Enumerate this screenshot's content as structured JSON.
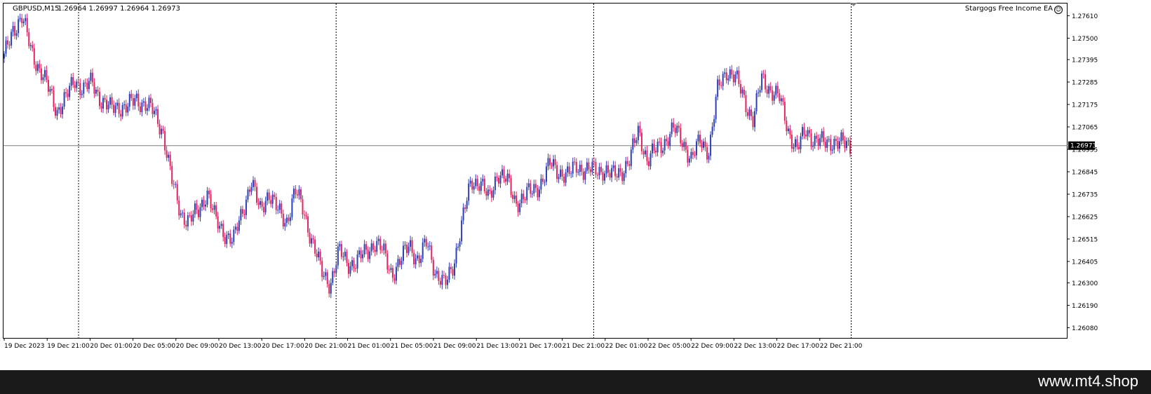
{
  "header": {
    "symbol": "GBPUSD,M15",
    "ohlc": "1.26964 1.26997 1.26964 1.26973",
    "ea_name": "Stargogs Free Income EA"
  },
  "icons": {
    "ea_status": "smiley-icon"
  },
  "watermark": "www.mt4.shop",
  "colors": {
    "bull": "#2a3fb8",
    "bear": "#e0245e",
    "grid": "#000000",
    "bid_line": "#7f7f7f",
    "price_label_bg": "#000000",
    "footer_bg": "#1a1a1a"
  },
  "chart_data": {
    "type": "candlestick",
    "symbol": "GBPUSD",
    "timeframe": "M15",
    "current_price": 1.26973,
    "current_price_label": "1.26973",
    "ylim": [
      1.2603,
      1.2767
    ],
    "y_ticks": [
      "1.27610",
      "1.27500",
      "1.27395",
      "1.27285",
      "1.27175",
      "1.27065",
      "1.26955",
      "1.26845",
      "1.26735",
      "1.26625",
      "1.26515",
      "1.26405",
      "1.26300",
      "1.26190",
      "1.26080"
    ],
    "x_ticks": [
      "19 Dec 2023",
      "19 Dec 21:00",
      "20 Dec 01:00",
      "20 Dec 05:00",
      "20 Dec 09:00",
      "20 Dec 13:00",
      "20 Dec 17:00",
      "20 Dec 21:00",
      "21 Dec 01:00",
      "21 Dec 05:00",
      "21 Dec 09:00",
      "21 Dec 13:00",
      "21 Dec 17:00",
      "21 Dec 21:00",
      "22 Dec 01:00",
      "22 Dec 05:00",
      "22 Dec 09:00",
      "22 Dec 13:00",
      "22 Dec 17:00",
      "22 Dec 21:00"
    ],
    "day_separators": [
      "19 Dec 21:00",
      "20 Dec 21:00",
      "21 Dec 21:00",
      "22 Dec 21:00"
    ],
    "close_path": [
      1.274,
      1.2755,
      1.276,
      1.2745,
      1.2735,
      1.2725,
      1.2715,
      1.272,
      1.273,
      1.2725,
      1.2728,
      1.272,
      1.2715,
      1.2717,
      1.2716,
      1.272,
      1.2718,
      1.2713,
      1.2705,
      1.268,
      1.2665,
      1.266,
      1.2665,
      1.2675,
      1.266,
      1.2655,
      1.265,
      1.2665,
      1.268,
      1.2665,
      1.2675,
      1.2665,
      1.266,
      1.2675,
      1.2665,
      1.265,
      1.2635,
      1.263,
      1.2645,
      1.264,
      1.264,
      1.2645,
      1.265,
      1.2645,
      1.2635,
      1.264,
      1.265,
      1.264,
      1.265,
      1.2635,
      1.2628,
      1.264,
      1.266,
      1.268,
      1.268,
      1.267,
      1.2685,
      1.268,
      1.267,
      1.2672,
      1.2675,
      1.268,
      1.2688,
      1.2685,
      1.2682,
      1.2688,
      1.2685,
      1.2685,
      1.2686,
      1.2682,
      1.2685,
      1.269,
      1.2705,
      1.269,
      1.2695,
      1.27,
      1.2705,
      1.27,
      1.269,
      1.27,
      1.2695,
      1.2725,
      1.2735,
      1.273,
      1.272,
      1.271,
      1.273,
      1.2725,
      1.272,
      1.2705,
      1.2695,
      1.2705,
      1.27,
      1.2698,
      1.27,
      1.2698,
      1.2697
    ],
    "series": [
      {
        "name": "GBPUSD,M15",
        "type": "candlestick"
      }
    ]
  }
}
